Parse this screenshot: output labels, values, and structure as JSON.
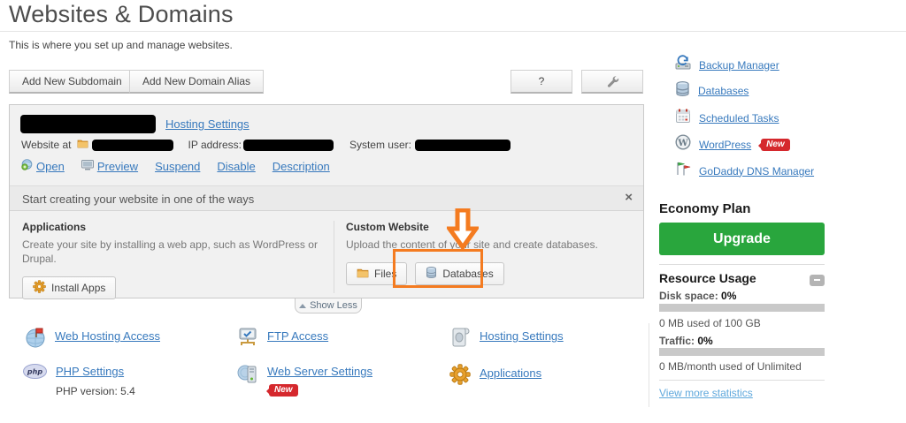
{
  "page": {
    "title": "Websites & Domains",
    "subtitle": "This is where you set up and manage websites."
  },
  "toolbar": {
    "add_subdomain": "Add New Subdomain",
    "add_alias": "Add New Domain Alias",
    "help": "?",
    "wrench_icon": "wrench"
  },
  "domain_panel": {
    "hosting_settings": "Hosting Settings",
    "website_at_label": "Website at",
    "ip_label": "IP address:",
    "system_user_label": "System user:",
    "actions": [
      {
        "label": "Open",
        "icon": "globe-icon"
      },
      {
        "label": "Preview",
        "icon": "preview-icon"
      },
      {
        "label": "Suspend"
      },
      {
        "label": "Disable"
      },
      {
        "label": "Description"
      }
    ]
  },
  "getting_started": {
    "title": "Start creating your website in one of the ways",
    "close": "×",
    "applications": {
      "heading": "Applications",
      "description": "Create your site by installing a web app, such as WordPress or Drupal.",
      "button": "Install Apps",
      "button_icon": "gear-icon"
    },
    "custom_website": {
      "heading": "Custom Website",
      "description": "Upload the content of your site and create databases.",
      "files_button": "Files",
      "files_icon": "folder-icon",
      "databases_button": "Databases",
      "databases_icon": "database-icon"
    },
    "show_less": "Show Less"
  },
  "quick_links": {
    "items": [
      {
        "label": "Web Hosting Access",
        "icon": "globe-flag-icon"
      },
      {
        "label": "FTP Access",
        "icon": "ftp-icon"
      },
      {
        "label": "Hosting Settings",
        "icon": "scroll-icon"
      },
      {
        "label": "PHP Settings",
        "icon": "php-icon",
        "sub": "PHP version: 5.4"
      },
      {
        "label": "Web Server Settings",
        "icon": "server-icon",
        "badge": "New"
      },
      {
        "label": "Applications",
        "icon": "gear-icon"
      }
    ]
  },
  "sidebar": {
    "links": [
      {
        "label": "Backup Manager",
        "icon": "backup-icon"
      },
      {
        "label": "Databases",
        "icon": "database-icon"
      },
      {
        "label": "Scheduled Tasks",
        "icon": "calendar-icon"
      },
      {
        "label": "WordPress",
        "icon": "wordpress-icon",
        "badge": "New"
      },
      {
        "label": "GoDaddy DNS Manager",
        "icon": "flags-icon"
      }
    ],
    "plan": {
      "name": "Economy Plan",
      "upgrade_button": "Upgrade"
    },
    "resource_usage": {
      "heading": "Resource Usage",
      "disk_label": "Disk space:",
      "disk_value": "0%",
      "disk_percent": 0,
      "disk_detail": "0 MB used of 100 GB",
      "traffic_label": "Traffic:",
      "traffic_value": "0%",
      "traffic_percent": 0,
      "traffic_detail": "0 MB/month used of Unlimited",
      "view_more": "View more statistics"
    }
  },
  "colors": {
    "highlight_orange": "#f47b20",
    "upgrade_green": "#29a63d",
    "badge_red": "#d5282d",
    "link_blue": "#3779bd",
    "light_link_blue": "#5fa8dc"
  }
}
